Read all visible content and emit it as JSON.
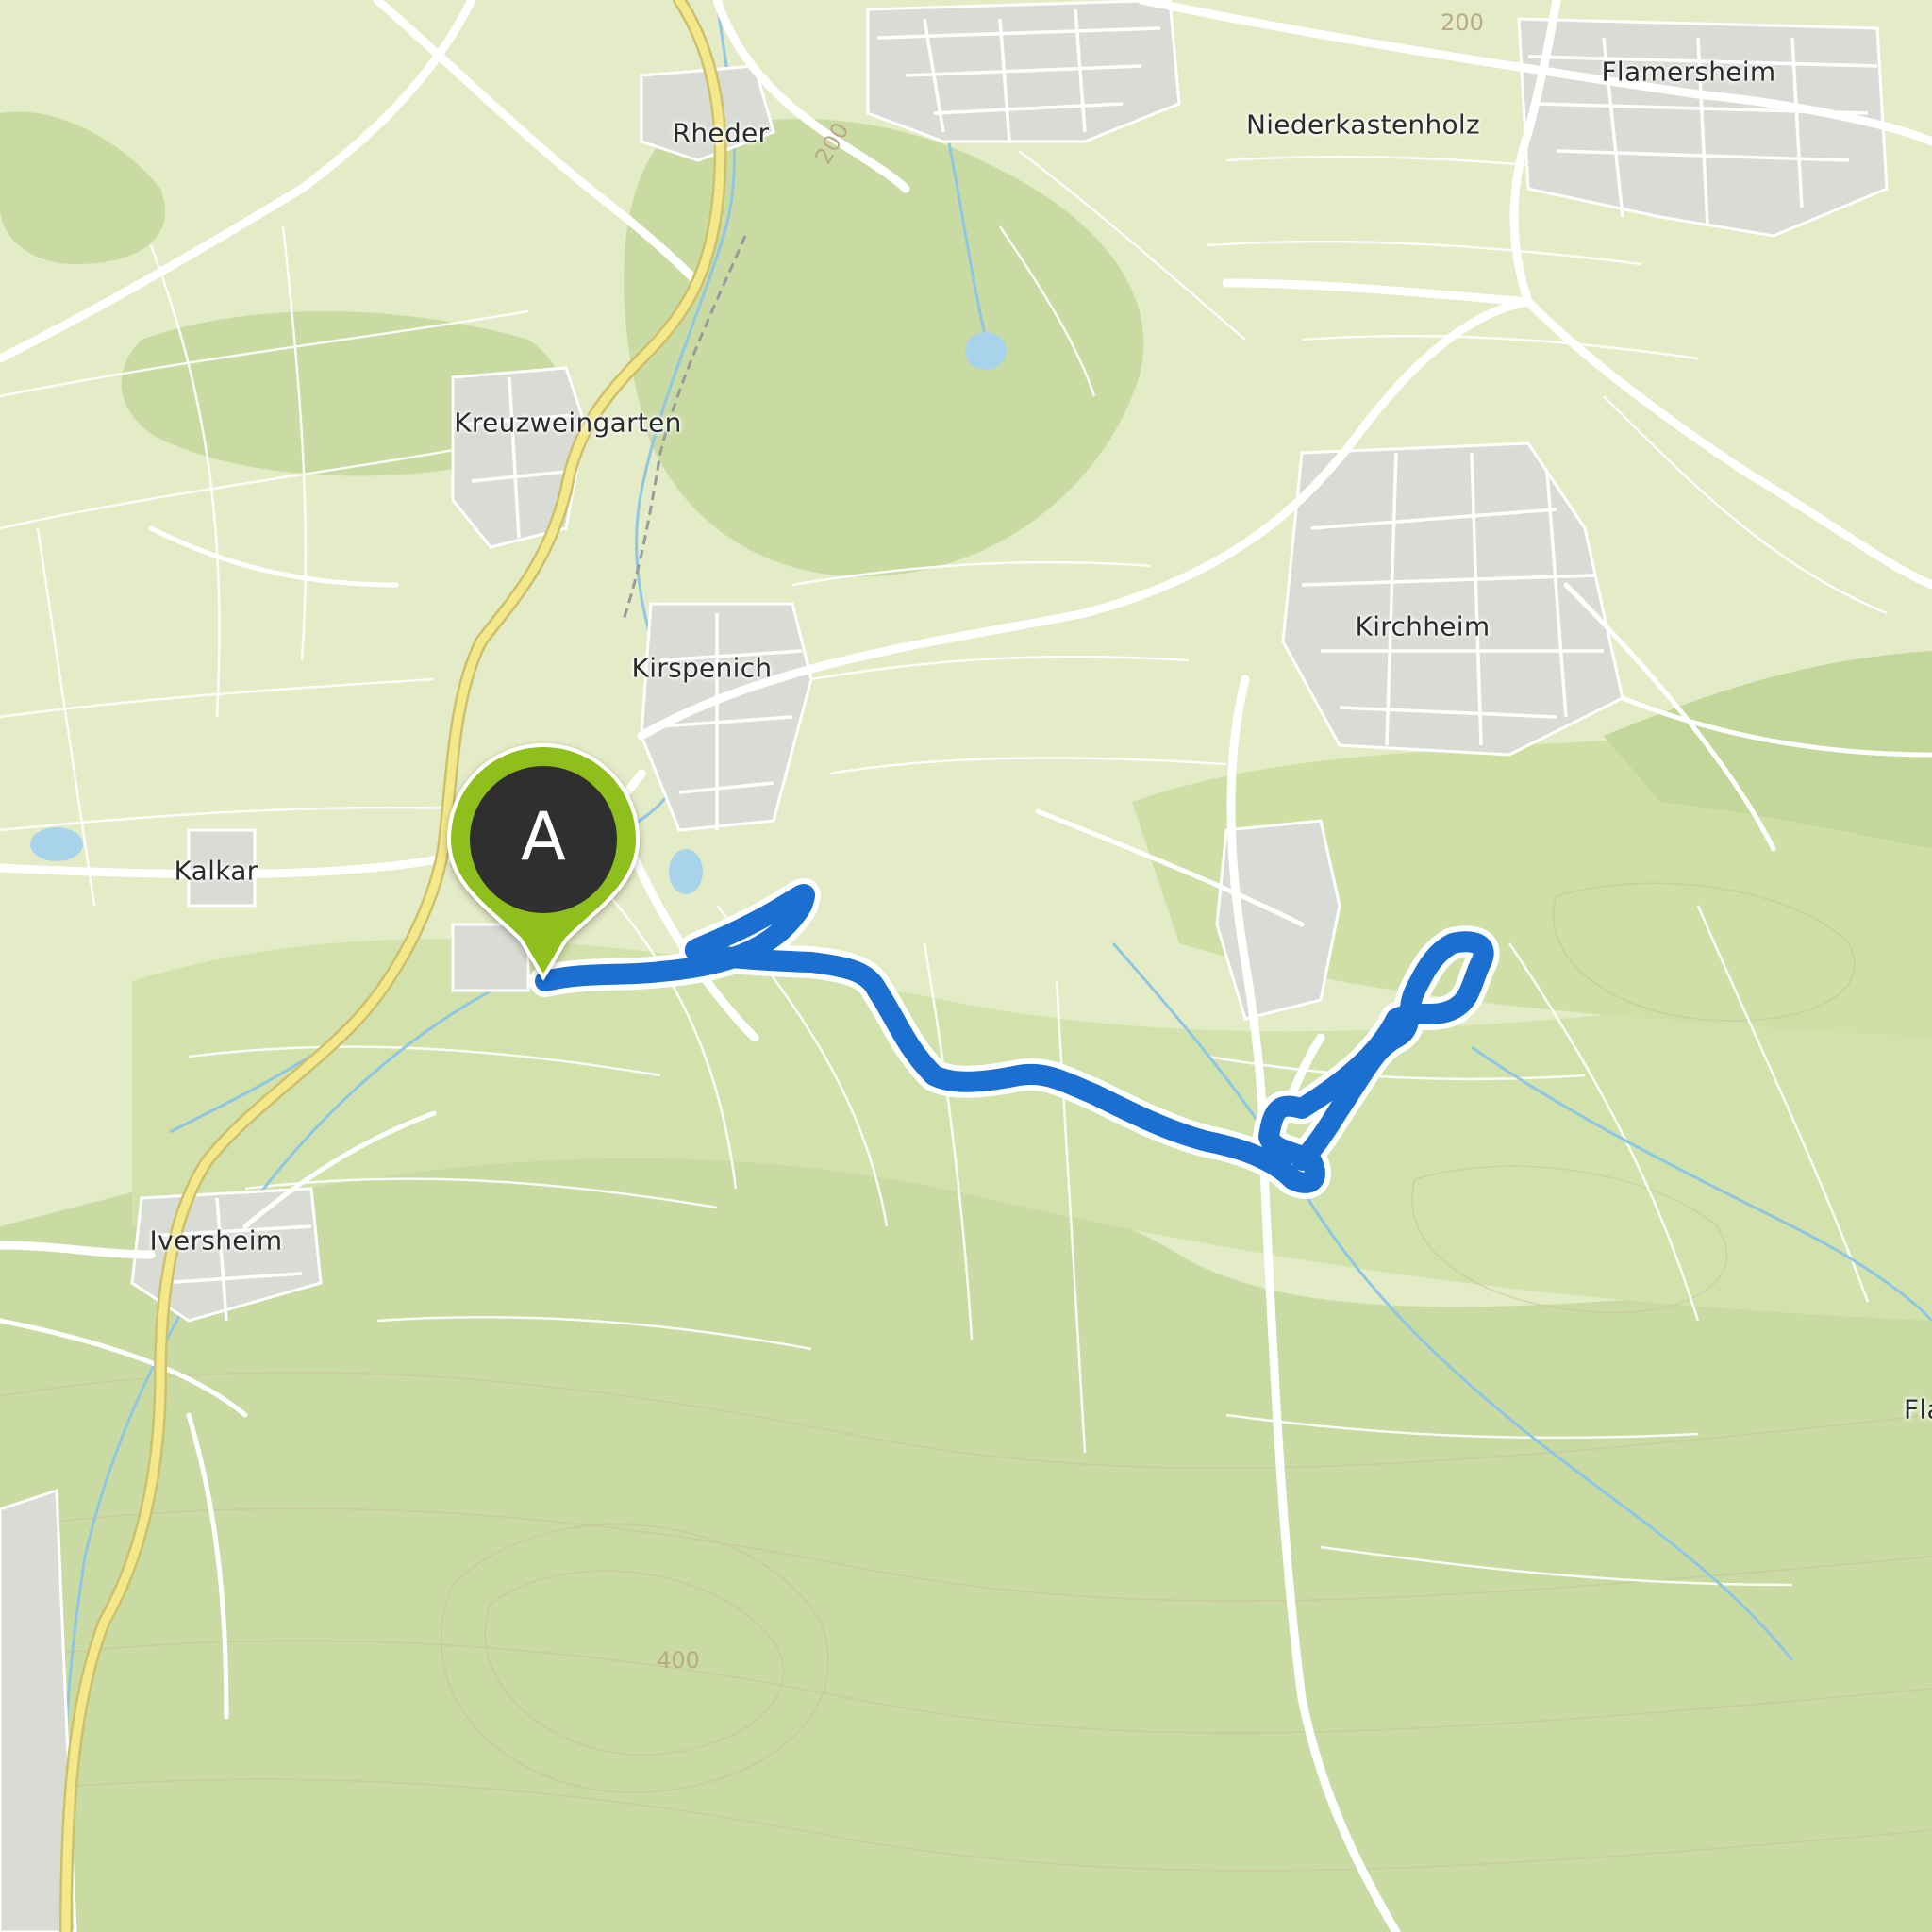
{
  "map": {
    "places": {
      "rheder": "Rheder",
      "niederkastenholz": "Niederkastenholz",
      "flamersheim": "Flamersheim",
      "kreuzweingarten": "Kreuzweingarten",
      "kirchheim": "Kirchheim",
      "kirspenich": "Kirspenich",
      "kalkar": "Kalkar",
      "iversheim": "Iversheim",
      "fla_partial": "Fla"
    },
    "elevation_labels": {
      "e200_north": "200",
      "e200_rheder": "200",
      "e400": "400"
    },
    "start_marker": {
      "letter": "A",
      "color": "#8fbf1a"
    },
    "route_color": "#1b6fd0",
    "colors": {
      "land": "#e4ebc7",
      "forest": "#c9dba2",
      "road": "#ffffff",
      "main_road": "#f3e98a",
      "water": "#a9d3ea",
      "settlement": "#d9dcd5"
    }
  }
}
